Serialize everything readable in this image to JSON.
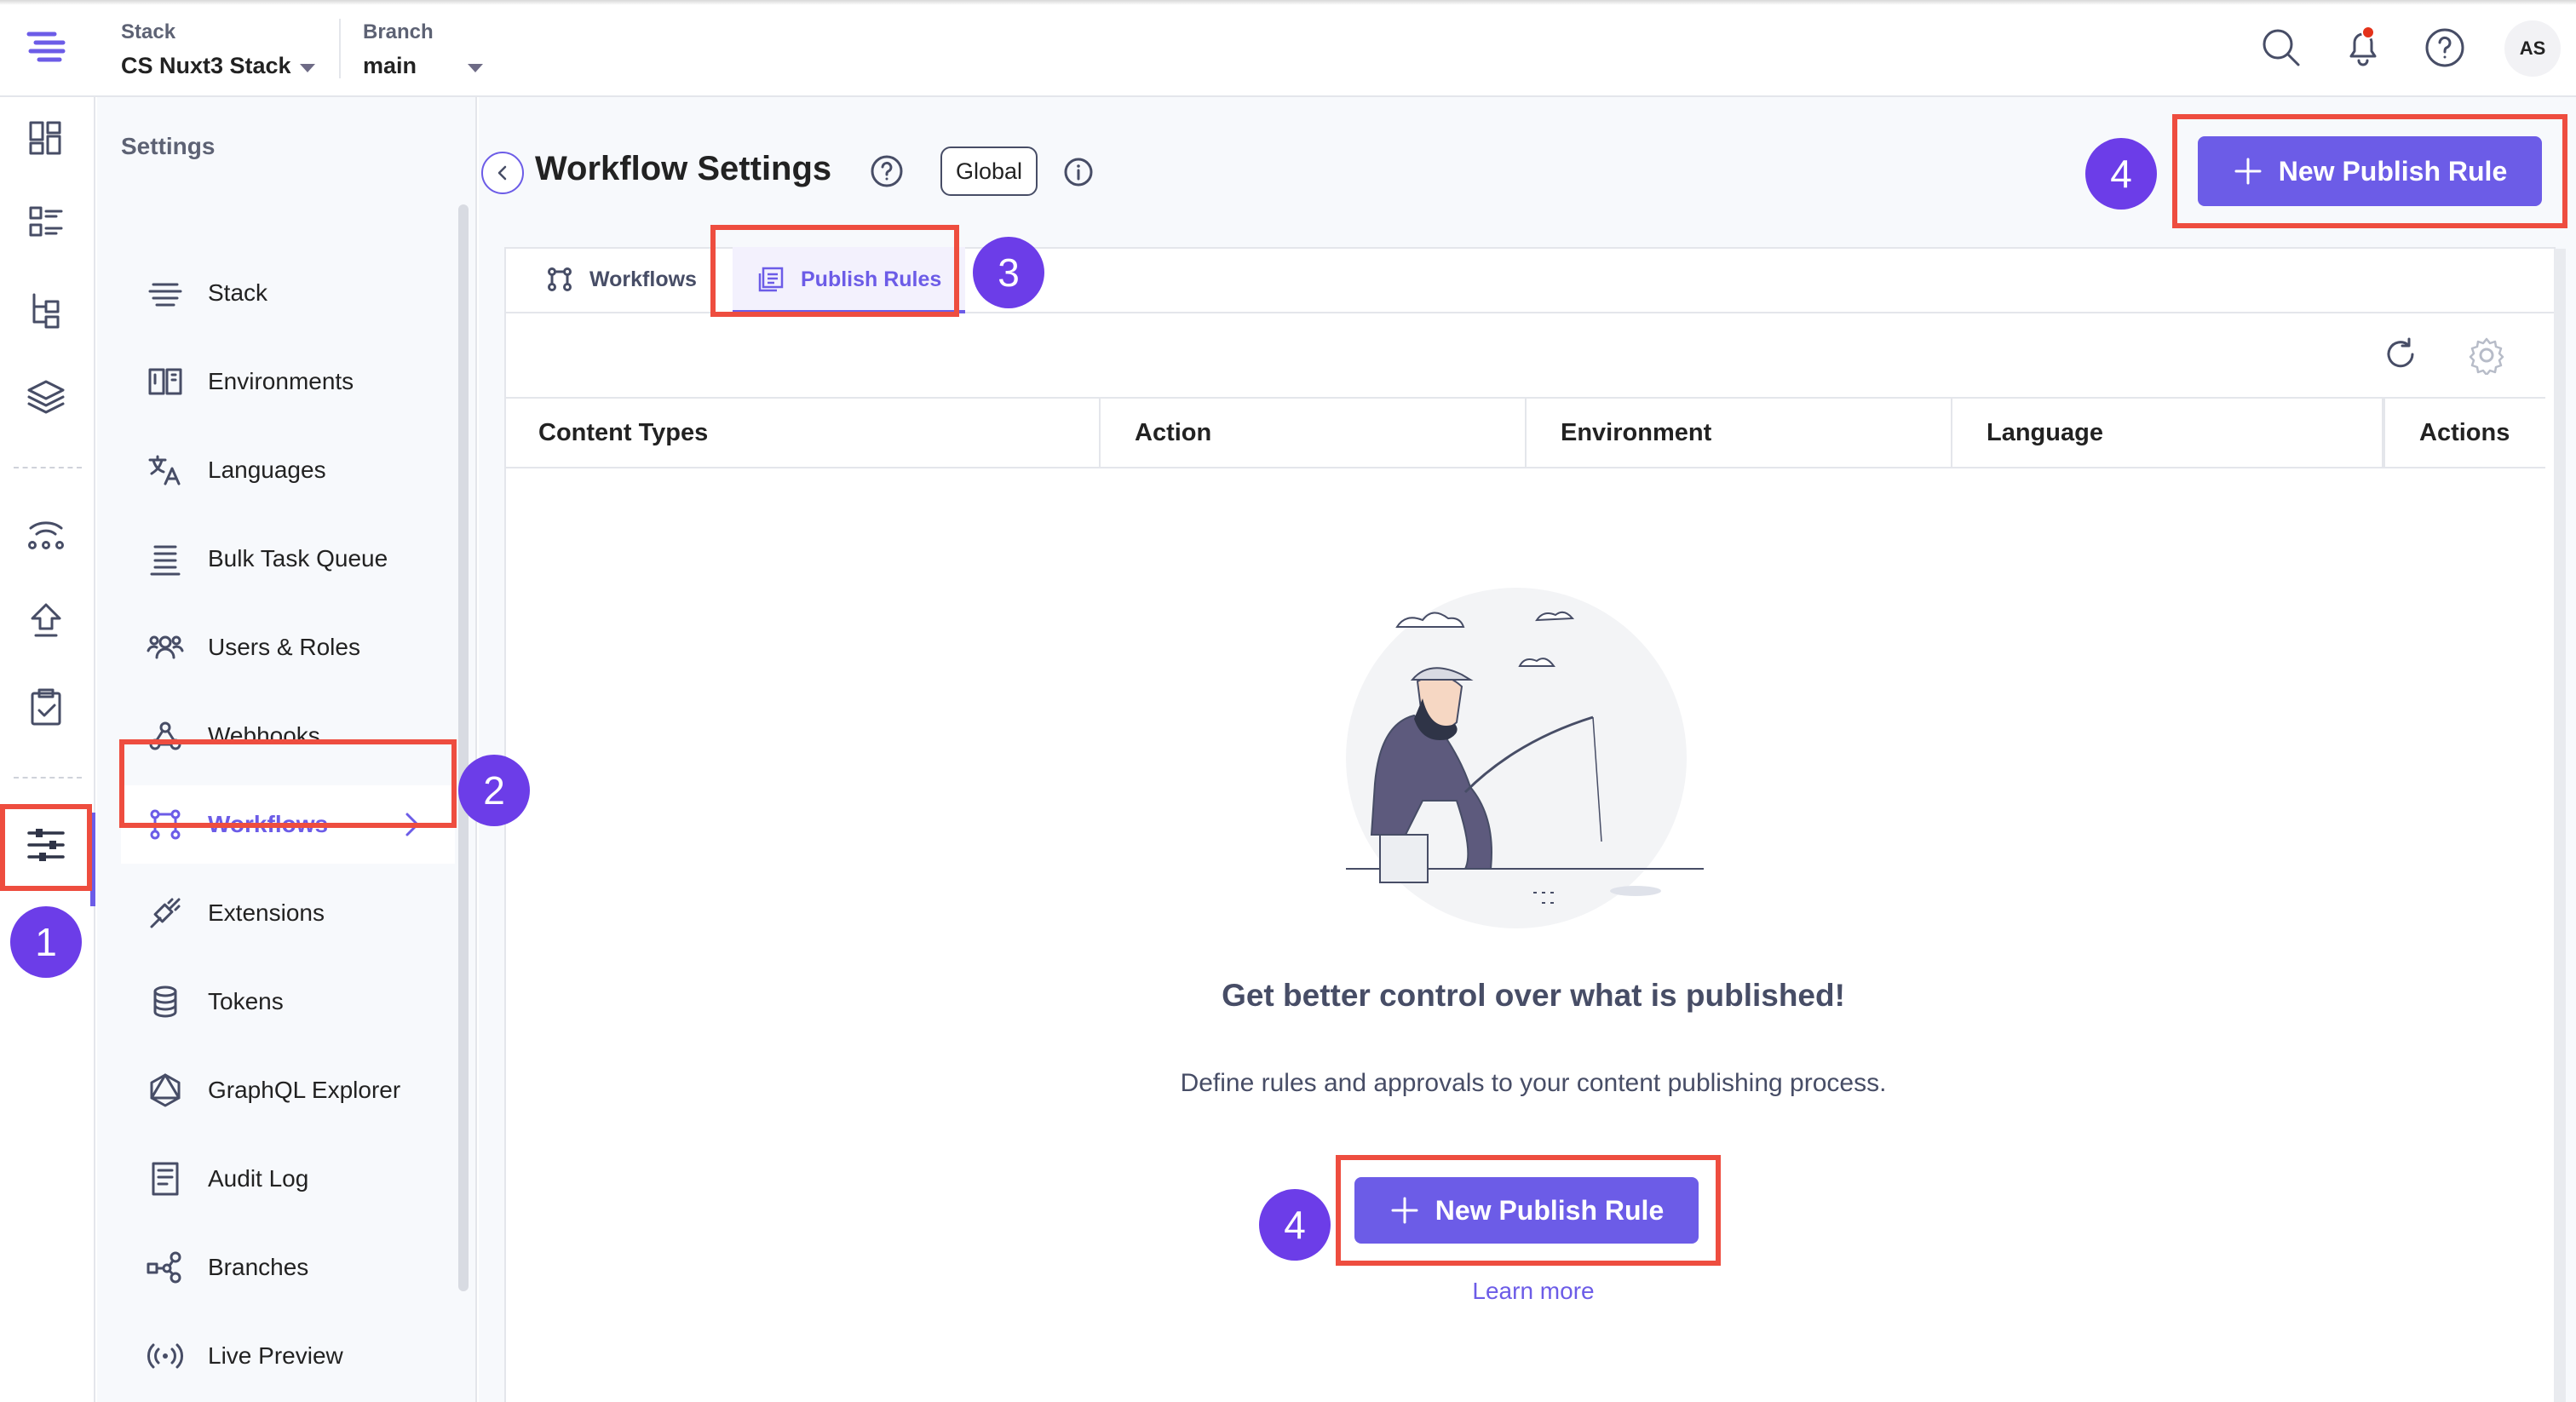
{
  "header": {
    "stack_label": "Stack",
    "stack_value": "CS Nuxt3 Stack",
    "branch_label": "Branch",
    "branch_value": "main",
    "avatar_initials": "AS",
    "icons": [
      "search-icon",
      "bell-icon",
      "help-icon"
    ]
  },
  "rail": {
    "icons": [
      "dashboard-icon",
      "entries-icon",
      "content-models-icon",
      "assets-icon",
      "deployments-icon",
      "publish-queue-icon",
      "tasks-icon",
      "settings-icon"
    ]
  },
  "settings_nav": {
    "title": "Settings",
    "items": [
      {
        "label": "Stack",
        "icon": "stack-icon"
      },
      {
        "label": "Environments",
        "icon": "environments-icon"
      },
      {
        "label": "Languages",
        "icon": "languages-icon"
      },
      {
        "label": "Bulk Task Queue",
        "icon": "bulk-task-queue-icon"
      },
      {
        "label": "Users & Roles",
        "icon": "users-roles-icon"
      },
      {
        "label": "Webhooks",
        "icon": "webhooks-icon"
      },
      {
        "label": "Workflows",
        "icon": "workflows-icon",
        "active": true
      },
      {
        "label": "Extensions",
        "icon": "extensions-icon"
      },
      {
        "label": "Tokens",
        "icon": "tokens-icon"
      },
      {
        "label": "GraphQL Explorer",
        "icon": "graphql-icon"
      },
      {
        "label": "Audit Log",
        "icon": "audit-log-icon"
      },
      {
        "label": "Branches",
        "icon": "branches-icon"
      },
      {
        "label": "Live Preview",
        "icon": "live-preview-icon"
      }
    ]
  },
  "page": {
    "title": "Workflow Settings",
    "scope_button": "Global",
    "new_rule_button": "New Publish Rule",
    "tabs": [
      {
        "label": "Workflows",
        "active": false
      },
      {
        "label": "Publish Rules",
        "active": true
      }
    ],
    "columns": [
      "Content Types",
      "Action",
      "Environment",
      "Language",
      "Actions"
    ],
    "empty_state": {
      "title": "Get better control over what is published!",
      "description": "Define rules and approvals to your content publishing process.",
      "button": "New Publish Rule",
      "link": "Learn more"
    }
  },
  "annotations": {
    "step1": "1",
    "step2": "2",
    "step3": "3",
    "step4_top": "4",
    "step4_bottom": "4"
  },
  "colors": {
    "accent": "#6c5ce7",
    "callout": "#ee4d3f",
    "badge": "#6c3de8",
    "notification": "#e4321a"
  }
}
